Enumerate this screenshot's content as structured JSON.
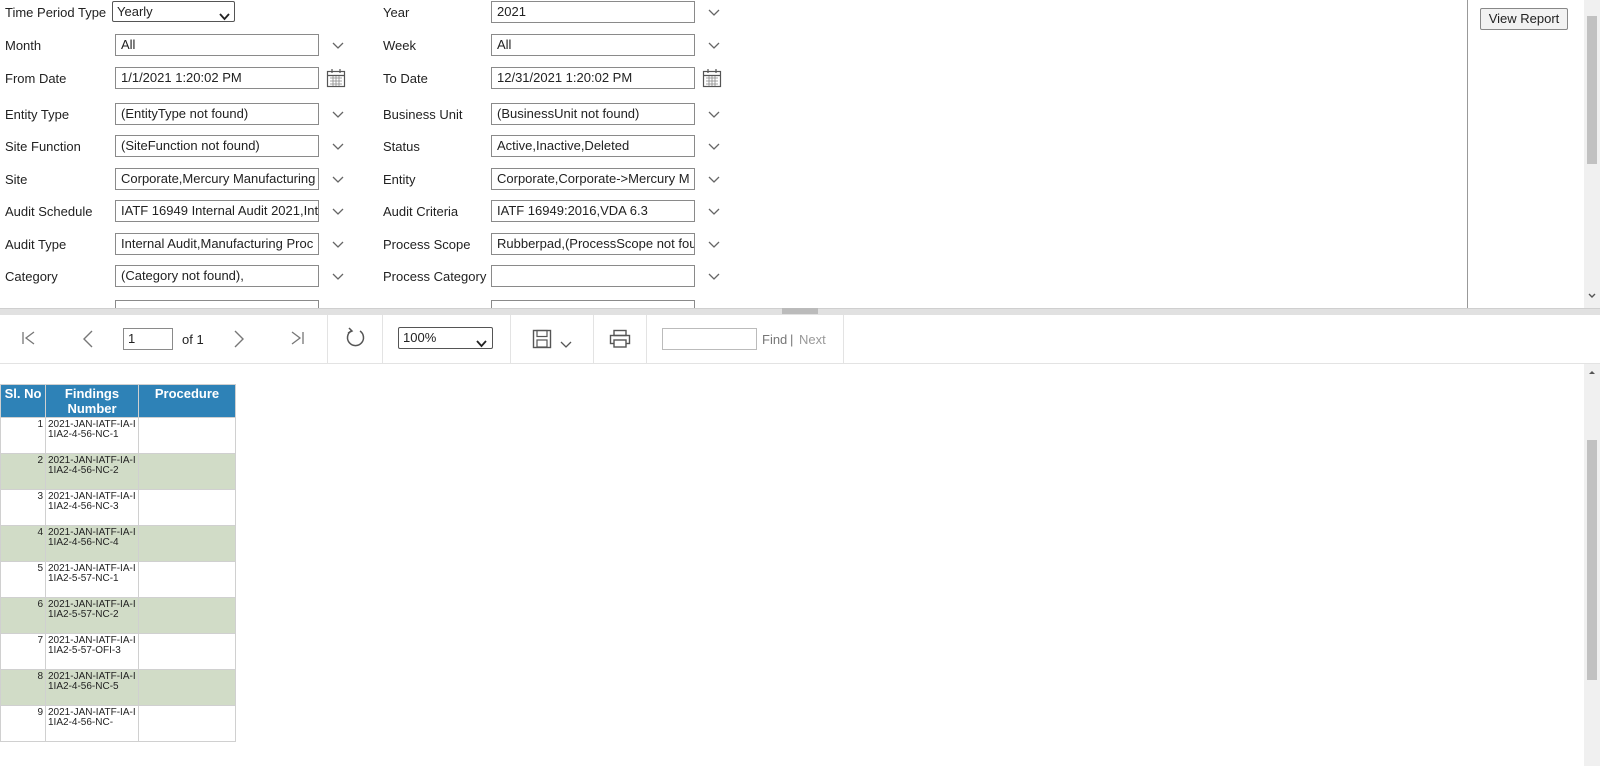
{
  "params": {
    "left": [
      {
        "label": "Time Period Type",
        "value": "Yearly",
        "kind": "select"
      },
      {
        "label": "Month",
        "value": "All",
        "kind": "dropdown"
      },
      {
        "label": "From Date",
        "value": "1/1/2021 1:20:02 PM",
        "kind": "date"
      },
      {
        "label": "Entity Type",
        "value": "(EntityType not found)",
        "kind": "dropdown"
      },
      {
        "label": "Site Function",
        "value": "(SiteFunction not found)",
        "kind": "dropdown"
      },
      {
        "label": "Site",
        "value": "Corporate,Mercury Manufacturing",
        "kind": "dropdown"
      },
      {
        "label": "Audit Schedule",
        "value": "IATF 16949 Internal Audit 2021,Int",
        "kind": "dropdown"
      },
      {
        "label": "Audit Type",
        "value": "Internal Audit,Manufacturing Proc",
        "kind": "dropdown"
      },
      {
        "label": "Category",
        "value": "(Category not found),",
        "kind": "dropdown"
      }
    ],
    "right": [
      {
        "label": "Year",
        "value": "2021",
        "kind": "dropdown"
      },
      {
        "label": "Week",
        "value": "All",
        "kind": "dropdown"
      },
      {
        "label": "To Date",
        "value": "12/31/2021 1:20:02 PM",
        "kind": "date"
      },
      {
        "label": "Business Unit",
        "value": "(BusinessUnit not found)",
        "kind": "dropdown"
      },
      {
        "label": "Status",
        "value": "Active,Inactive,Deleted",
        "kind": "dropdown"
      },
      {
        "label": "Entity",
        "value": "Corporate,Corporate->Mercury M",
        "kind": "dropdown"
      },
      {
        "label": "Audit Criteria",
        "value": "IATF 16949:2016,VDA 6.3",
        "kind": "dropdown"
      },
      {
        "label": "Process Scope",
        "value": "Rubberpad,(ProcessScope not fou",
        "kind": "dropdown"
      },
      {
        "label": "Process Category",
        "value": "",
        "kind": "dropdown"
      }
    ],
    "view_report_label": "View Report"
  },
  "toolbar": {
    "page_value": "1",
    "page_of": "of 1",
    "zoom": "100%",
    "find_label": "Find",
    "find_separator": "|",
    "next_label": "Next"
  },
  "table": {
    "headers": [
      "Sl. No",
      "Findings Number",
      "Procedure"
    ],
    "rows": [
      {
        "sl": "1",
        "finding": "2021-JAN-IATF-IA-I1IA2-4-56-NC-1",
        "procedure": ""
      },
      {
        "sl": "2",
        "finding": "2021-JAN-IATF-IA-I1IA2-4-56-NC-2",
        "procedure": ""
      },
      {
        "sl": "3",
        "finding": "2021-JAN-IATF-IA-I1IA2-4-56-NC-3",
        "procedure": ""
      },
      {
        "sl": "4",
        "finding": "2021-JAN-IATF-IA-I1IA2-4-56-NC-4",
        "procedure": ""
      },
      {
        "sl": "5",
        "finding": "2021-JAN-IATF-IA-I1IA2-5-57-NC-1",
        "procedure": ""
      },
      {
        "sl": "6",
        "finding": "2021-JAN-IATF-IA-I1IA2-5-57-NC-2",
        "procedure": ""
      },
      {
        "sl": "7",
        "finding": "2021-JAN-IATF-IA-I1IA2-5-57-OFI-3",
        "procedure": ""
      },
      {
        "sl": "8",
        "finding": "2021-JAN-IATF-IA-I1IA2-4-56-NC-5",
        "procedure": ""
      },
      {
        "sl": "9",
        "finding": "2021-JAN-IATF-IA-I1IA2-4-56-NC-",
        "procedure": ""
      }
    ]
  },
  "colors": {
    "header_bg": "#2e82b7",
    "alt_row_bg": "#d1dcc7"
  }
}
